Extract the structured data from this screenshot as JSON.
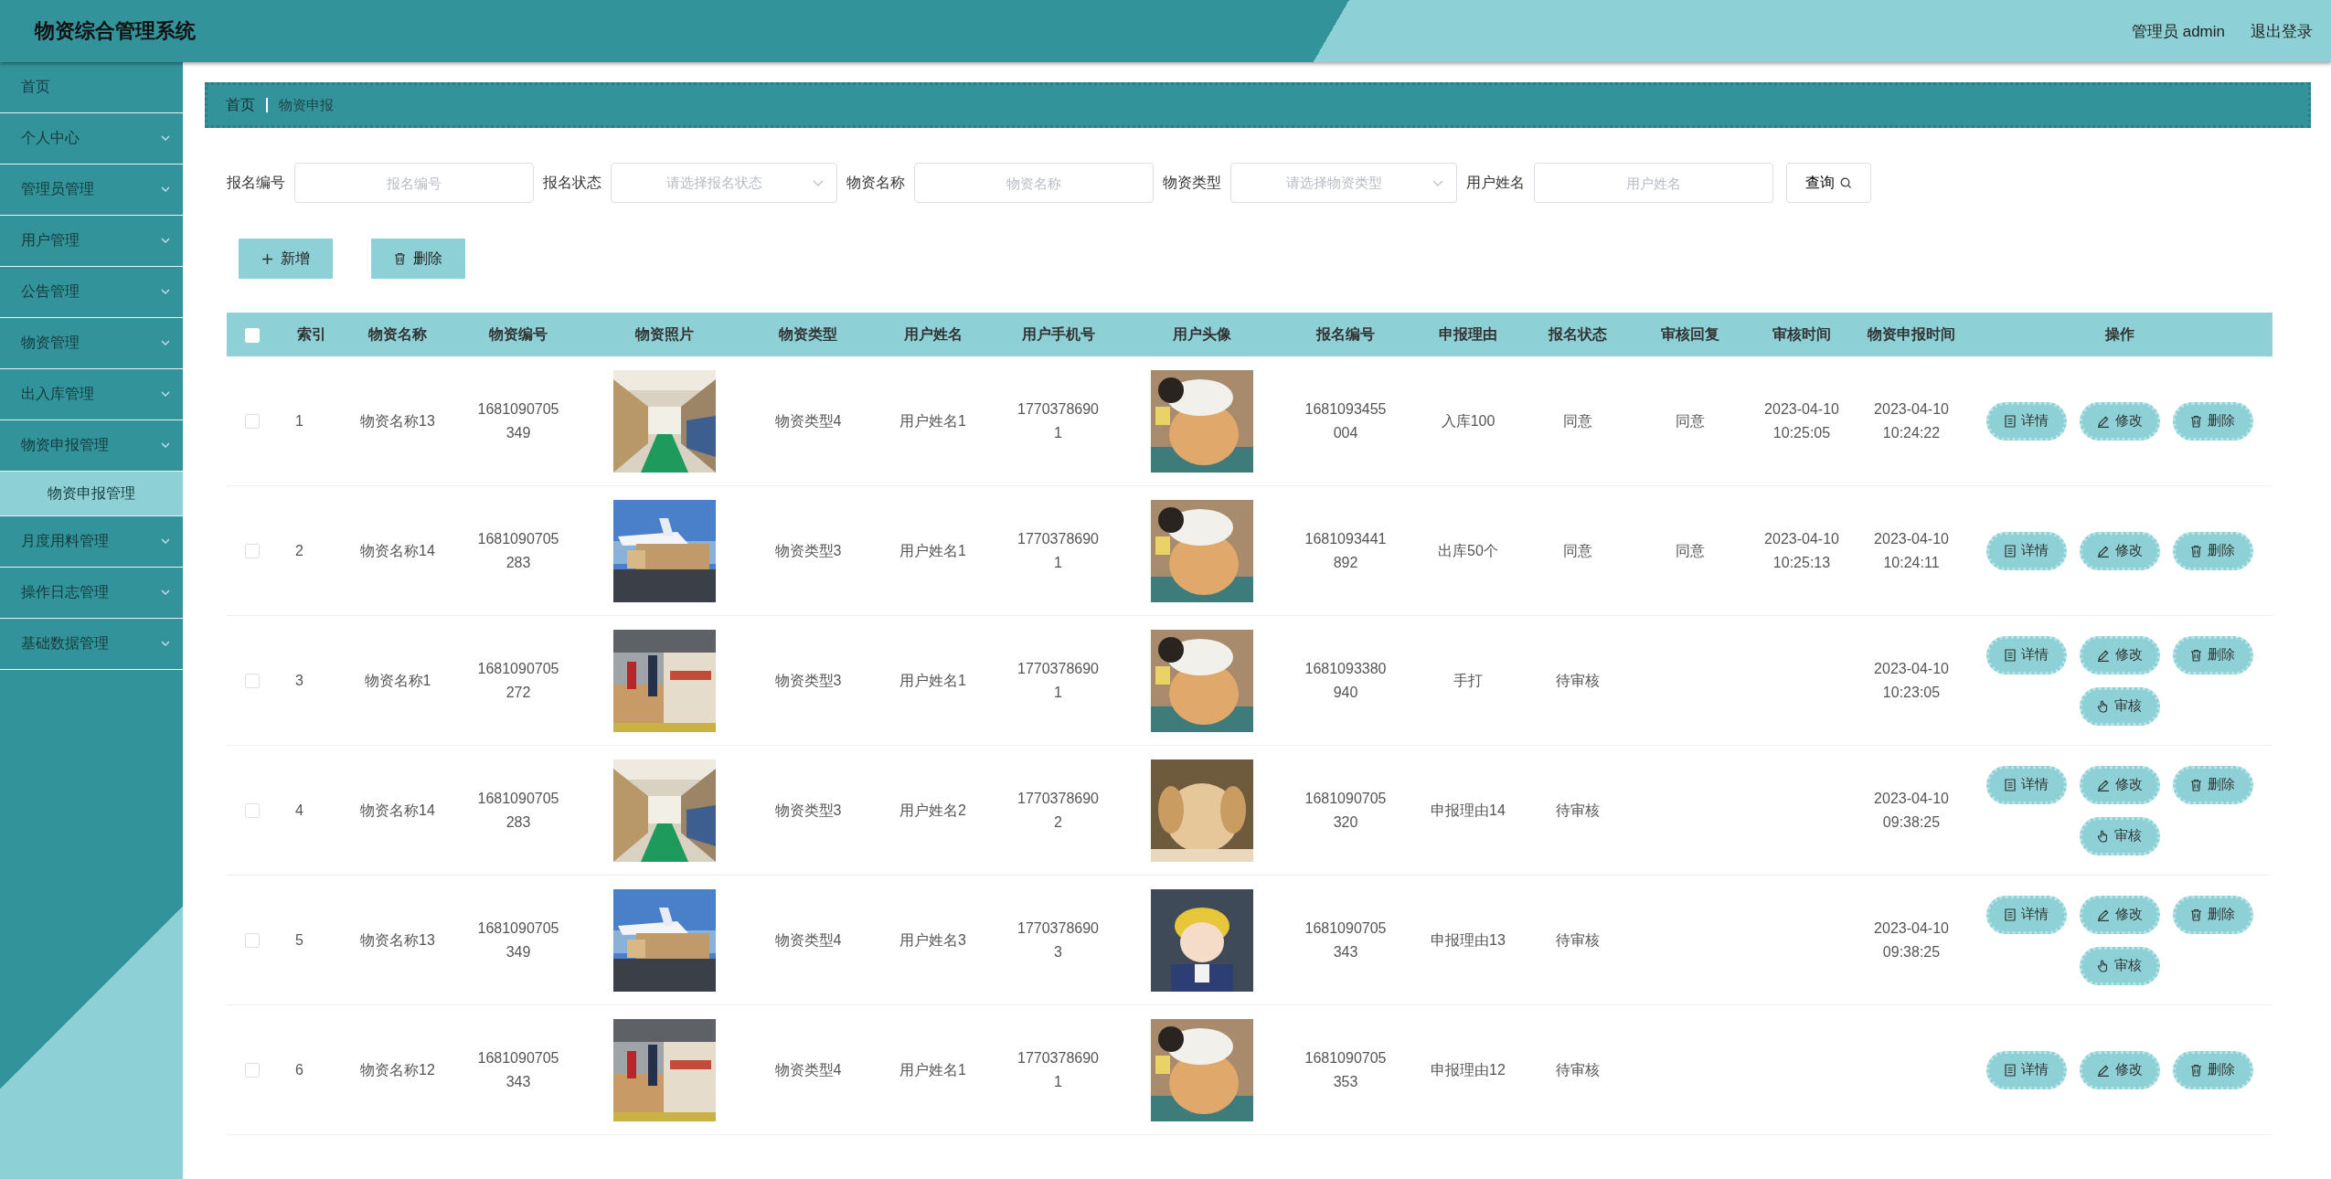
{
  "header": {
    "title": "物资综合管理系统",
    "user": "管理员 admin",
    "logout": "退出登录"
  },
  "sidebar": {
    "items": [
      {
        "label": "首页",
        "expandable": false
      },
      {
        "label": "个人中心",
        "expandable": true
      },
      {
        "label": "管理员管理",
        "expandable": true
      },
      {
        "label": "用户管理",
        "expandable": true
      },
      {
        "label": "公告管理",
        "expandable": true
      },
      {
        "label": "物资管理",
        "expandable": true
      },
      {
        "label": "出入库管理",
        "expandable": true
      },
      {
        "label": "物资申报管理",
        "expandable": true,
        "expanded": true,
        "children": [
          {
            "label": "物资申报管理",
            "selected": true
          }
        ]
      },
      {
        "label": "月度用料管理",
        "expandable": true
      },
      {
        "label": "操作日志管理",
        "expandable": true
      },
      {
        "label": "基础数据管理",
        "expandable": true
      }
    ]
  },
  "breadcrumb": [
    "首页",
    "物资申报"
  ],
  "search": {
    "fields": [
      {
        "label": "报名编号",
        "kind": "input",
        "placeholder": "报名编号"
      },
      {
        "label": "报名状态",
        "kind": "select",
        "placeholder": "请选择报名状态"
      },
      {
        "label": "物资名称",
        "kind": "input",
        "placeholder": "物资名称"
      },
      {
        "label": "物资类型",
        "kind": "select",
        "placeholder": "请选择物资类型"
      },
      {
        "label": "用户姓名",
        "kind": "input",
        "placeholder": "用户姓名"
      }
    ],
    "button": "查询"
  },
  "toolbar": [
    {
      "label": "新增",
      "kind": "add"
    },
    {
      "label": "删除",
      "kind": "delete"
    }
  ],
  "table": {
    "select_all": {
      "checked": false
    },
    "columns": [
      "索引",
      "物资名称",
      "物资编号",
      "物资照片",
      "物资类型",
      "用户姓名",
      "用户手机号",
      "用户头像",
      "报名编号",
      "申报理由",
      "报名状态",
      "审核回复",
      "审核时间",
      "物资申报时间",
      "操作"
    ],
    "rows": [
      {
        "checked": false,
        "index": "1",
        "name": "物资名称13",
        "code": "1681090705349",
        "photo": {
          "kind": "picture"
        },
        "type": "物资类型4",
        "user": "用户姓名1",
        "phone": "17703786901",
        "avatar": {
          "kind": "picture"
        },
        "report_no": "1681093455004",
        "reason": "入库100",
        "status": "同意",
        "reply": "同意",
        "review_time": "2023-04-10 10:25:05",
        "report_time": "2023-04-10 10:24:22",
        "actions": [
          {
            "label": "详情",
            "kind": "detail"
          },
          {
            "label": "修改",
            "kind": "edit"
          },
          {
            "label": "删除",
            "kind": "delete"
          }
        ]
      },
      {
        "checked": false,
        "index": "2",
        "name": "物资名称14",
        "code": "1681090705283",
        "photo": {
          "kind": "picture"
        },
        "type": "物资类型3",
        "user": "用户姓名1",
        "phone": "17703786901",
        "avatar": {
          "kind": "picture"
        },
        "report_no": "1681093441892",
        "reason": "出库50个",
        "status": "同意",
        "reply": "同意",
        "review_time": "2023-04-10 10:25:13",
        "report_time": "2023-04-10 10:24:11",
        "actions": [
          {
            "label": "详情",
            "kind": "detail"
          },
          {
            "label": "修改",
            "kind": "edit"
          },
          {
            "label": "删除",
            "kind": "delete"
          }
        ]
      },
      {
        "checked": false,
        "index": "3",
        "name": "物资名称1",
        "code": "1681090705272",
        "photo": {
          "kind": "picture"
        },
        "type": "物资类型3",
        "user": "用户姓名1",
        "phone": "17703786901",
        "avatar": {
          "kind": "picture"
        },
        "report_no": "1681093380940",
        "reason": "手打",
        "status": "待审核",
        "report_time": "2023-04-10 10:23:05",
        "actions": [
          {
            "label": "详情",
            "kind": "detail"
          },
          {
            "label": "修改",
            "kind": "edit"
          },
          {
            "label": "删除",
            "kind": "delete"
          },
          {
            "label": "审核",
            "kind": "review"
          }
        ]
      },
      {
        "checked": false,
        "index": "4",
        "name": "物资名称14",
        "code": "1681090705283",
        "photo": {
          "kind": "picture"
        },
        "type": "物资类型3",
        "user": "用户姓名2",
        "phone": "17703786902",
        "avatar": {
          "kind": "picture"
        },
        "report_no": "1681090705320",
        "reason": "申报理由14",
        "status": "待审核",
        "report_time": "2023-04-10 09:38:25",
        "actions": [
          {
            "label": "详情",
            "kind": "detail"
          },
          {
            "label": "修改",
            "kind": "edit"
          },
          {
            "label": "删除",
            "kind": "delete"
          },
          {
            "label": "审核",
            "kind": "review"
          }
        ]
      },
      {
        "checked": false,
        "index": "5",
        "name": "物资名称13",
        "code": "1681090705349",
        "photo": {
          "kind": "picture"
        },
        "type": "物资类型4",
        "user": "用户姓名3",
        "phone": "17703786903",
        "avatar": {
          "kind": "picture"
        },
        "report_no": "1681090705343",
        "reason": "申报理由13",
        "status": "待审核",
        "report_time": "2023-04-10 09:38:25",
        "actions": [
          {
            "label": "详情",
            "kind": "detail"
          },
          {
            "label": "修改",
            "kind": "edit"
          },
          {
            "label": "删除",
            "kind": "delete"
          },
          {
            "label": "审核",
            "kind": "review"
          }
        ]
      },
      {
        "checked": false,
        "index": "6",
        "name": "物资名称12",
        "code": "1681090705343",
        "photo": {
          "kind": "picture"
        },
        "type": "物资类型4",
        "user": "用户姓名1",
        "phone": "17703786901",
        "avatar": {
          "kind": "picture"
        },
        "report_no": "1681090705353",
        "reason": "申报理由12",
        "status": "待审核",
        "actions": [
          {
            "label": "详情",
            "kind": "detail"
          },
          {
            "label": "修改",
            "kind": "edit"
          },
          {
            "label": "删除",
            "kind": "delete"
          }
        ]
      }
    ]
  }
}
